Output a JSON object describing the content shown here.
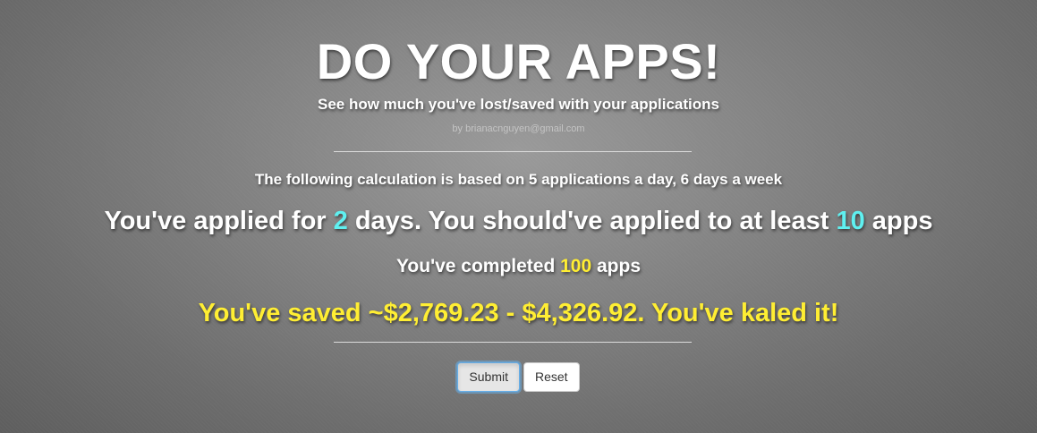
{
  "header": {
    "title": "DO YOUR APPS!",
    "subtitle": "See how much you've lost/saved with your applications",
    "byline": "by brianacnguyen@gmail.com"
  },
  "results": {
    "basis_text": "The following calculation is based on 5 applications a day, 6 days a week",
    "applied_prefix": "You've applied for ",
    "applied_days": "2",
    "applied_middle": " days. You should've applied to at least ",
    "applied_target": "10",
    "applied_suffix": " apps",
    "completed_prefix": "You've completed ",
    "completed_count": "100",
    "completed_suffix": " apps",
    "saved_text": "You've saved ~$2,769.23 - $4,326.92. You've kaled it!"
  },
  "actions": {
    "submit_label": "Submit",
    "reset_label": "Reset"
  },
  "colors": {
    "highlight_cyan": "#5ff0f0",
    "highlight_yellow": "#ffee33",
    "focus_blue": "#66afe9"
  }
}
